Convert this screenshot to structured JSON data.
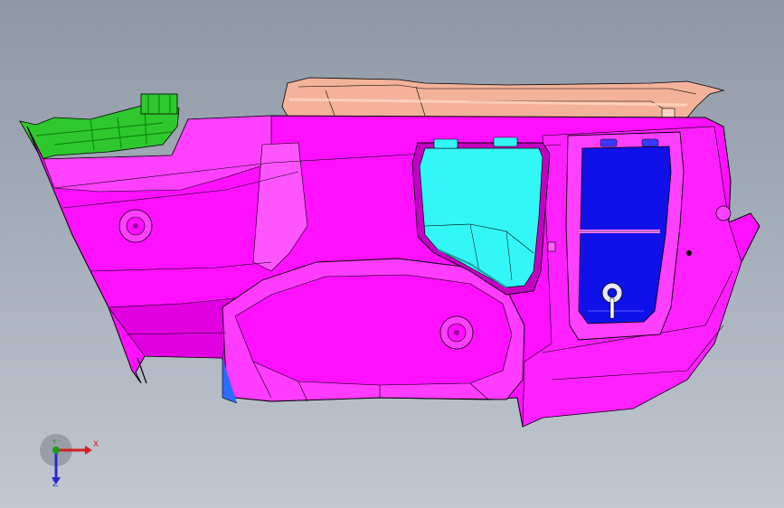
{
  "viewport": {
    "background_top": "#8f98a6",
    "background_bottom": "#c2c8d1"
  },
  "model": {
    "colors": {
      "main_body": "#ff10ff",
      "main_body_shade": "#d600d6",
      "main_body_light": "#ff66ff",
      "top_cover": "#f4b29a",
      "top_cover_light": "#ffd4c4",
      "bracket": "#2ec82e",
      "bracket_dark": "#0f8a0f",
      "window_glass": "#33f6f6",
      "panel_insert": "#1010e8",
      "edge_line": "#000000"
    },
    "parts": [
      "main-body",
      "top-cover",
      "left-bracket",
      "window-opening",
      "rear-panel-insert",
      "boss-left",
      "boss-center",
      "drain-fitting"
    ]
  },
  "triad": {
    "x_label": "X",
    "y_label": "Y",
    "z_label": "Z",
    "x_color": "#d42020",
    "y_color": "#1a9a1a",
    "z_color": "#2a2ad0"
  }
}
